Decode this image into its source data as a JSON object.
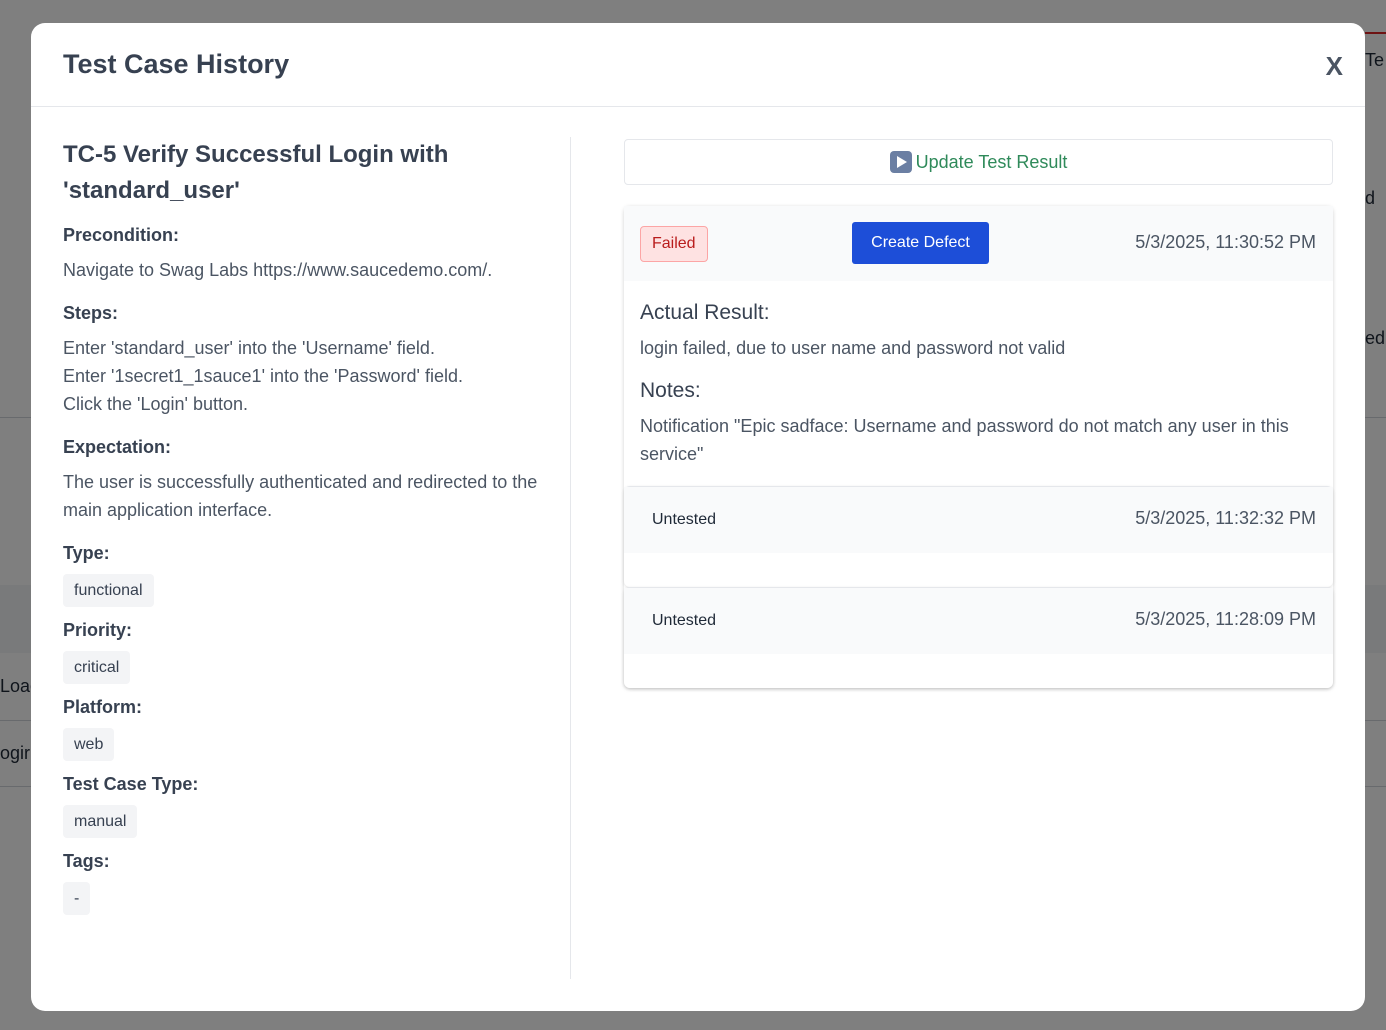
{
  "background": {
    "fragments": [
      "Te",
      "d",
      "ed",
      "Loac",
      "ogir"
    ]
  },
  "modal": {
    "title": "Test Case History",
    "close_label": "X"
  },
  "test_case": {
    "title": "TC-5 Verify Successful Login with 'standard_user'",
    "precondition_label": "Precondition:",
    "precondition": "Navigate to Swag Labs https://www.saucedemo.com/.",
    "steps_label": "Steps:",
    "steps": [
      "Enter 'standard_user' into the 'Username' field.",
      "Enter '1secret1_1sauce1' into the 'Password' field.",
      "Click the 'Login' button."
    ],
    "expectation_label": "Expectation:",
    "expectation": "The user is successfully authenticated and redirected to the main application interface.",
    "type_label": "Type:",
    "type": "functional",
    "priority_label": "Priority:",
    "priority": "critical",
    "platform_label": "Platform:",
    "platform": "web",
    "test_case_type_label": "Test Case Type:",
    "test_case_type": "manual",
    "tags_label": "Tags:",
    "tags": "-"
  },
  "actions": {
    "update_result_label": "Update Test Result",
    "play_icon": "play-button-icon"
  },
  "history": {
    "latest": {
      "status": "Failed",
      "create_defect_label": "Create Defect",
      "timestamp": "5/3/2025, 11:30:52 PM",
      "actual_result_label": "Actual Result:",
      "actual_result": "login failed, due to user name and password not valid",
      "notes_label": "Notes:",
      "notes": "Notification \"Epic sadface: Username and password do not match any user in this service\""
    },
    "entries": [
      {
        "status": "Untested",
        "timestamp": "5/3/2025, 11:32:32 PM"
      },
      {
        "status": "Untested",
        "timestamp": "5/3/2025, 11:28:09 PM"
      }
    ]
  },
  "colors": {
    "failed_badge_bg": "#fee2e2",
    "failed_badge_text": "#b91c1c",
    "create_defect_bg": "#1d4ed8",
    "update_result_text": "#2f8a5a"
  }
}
